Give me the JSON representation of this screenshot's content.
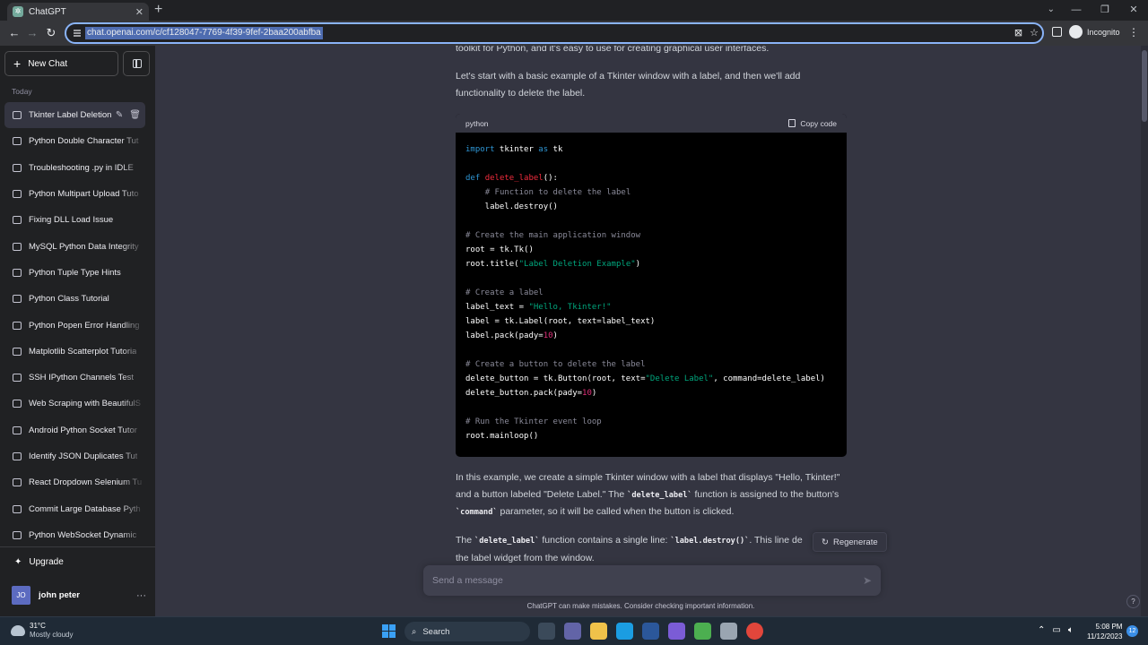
{
  "browser": {
    "tab_title": "ChatGPT",
    "tab_favicon": "openai-icon",
    "url": "chat.openai.com/c/cf128047-7769-4f39-9fef-2baa200abfba",
    "profile_label": "Incognito",
    "accent_color": "#8ab4f8"
  },
  "sidebar": {
    "new_chat_label": "New Chat",
    "section_label": "Today",
    "chats": [
      "Tkinter Label Deletion",
      "Python Double Character Tut",
      "Troubleshooting .py in IDLE",
      "Python Multipart Upload Tuto",
      "Fixing DLL Load Issue",
      "MySQL Python Data Integrity",
      "Python Tuple Type Hints",
      "Python Class Tutorial",
      "Python Popen Error Handling",
      "Matplotlib Scatterplot Tutoria",
      "SSH IPython Channels Test",
      "Web Scraping with BeautifulS",
      "Android Python Socket Tutor",
      "Identify JSON Duplicates Tut",
      "React Dropdown Selenium Tu",
      "Commit Large Database Pyth",
      "Python WebSocket Dynamic"
    ],
    "active_chat_index": 0,
    "upgrade_label": "Upgrade",
    "user_initials": "JO",
    "user_name": "john peter"
  },
  "conversation": {
    "intro_top": "toolkit for Python, and it's easy to use for creating graphical user interfaces.",
    "intro_p2": "Let's start with a basic example of a Tkinter window with a label, and then we'll add functionality to delete the label.",
    "code_language": "python",
    "copy_label": "Copy code",
    "code_lines": [
      "import tkinter as tk",
      "",
      "def delete_label():",
      "    # Function to delete the label",
      "    label.destroy()",
      "",
      "# Create the main application window",
      "root = tk.Tk()",
      "root.title(\"Label Deletion Example\")",
      "",
      "# Create a label",
      "label_text = \"Hello, Tkinter!\"",
      "label = tk.Label(root, text=label_text)",
      "label.pack(pady=10)",
      "",
      "# Create a button to delete the label",
      "delete_button = tk.Button(root, text=\"Delete Label\", command=delete_label)",
      "delete_button.pack(pady=10)",
      "",
      "# Run the Tkinter event loop",
      "root.mainloop()"
    ],
    "after_code_p1_a": "In this example, we create a simple Tkinter window with a label that displays \"Hello, Tkinter!\" and a button labeled \"Delete Label.\" The ",
    "after_code_p1_code1": "`delete_label`",
    "after_code_p1_b": " function is assigned to the button's ",
    "after_code_p1_code2": "`command`",
    "after_code_p1_c": " parameter, so it will be called when the button is clicked.",
    "after_code_p2_a": "The ",
    "after_code_p2_code1": "`delete_label`",
    "after_code_p2_b": " function contains a single line: ",
    "after_code_p2_code2": "`label.destroy()`",
    "after_code_p2_c": ". This line de",
    "after_code_p2_d": "the label widget from the window.",
    "regenerate_label": "Regenerate",
    "input_placeholder": "Send a message",
    "disclaimer": "ChatGPT can make mistakes. Consider checking important information.",
    "help_label": "?"
  },
  "taskbar": {
    "temperature": "31°C",
    "weather_desc": "Mostly cloudy",
    "search_label": "Search",
    "time": "5:08 PM",
    "date": "11/12/2023",
    "notification_count": "12"
  }
}
